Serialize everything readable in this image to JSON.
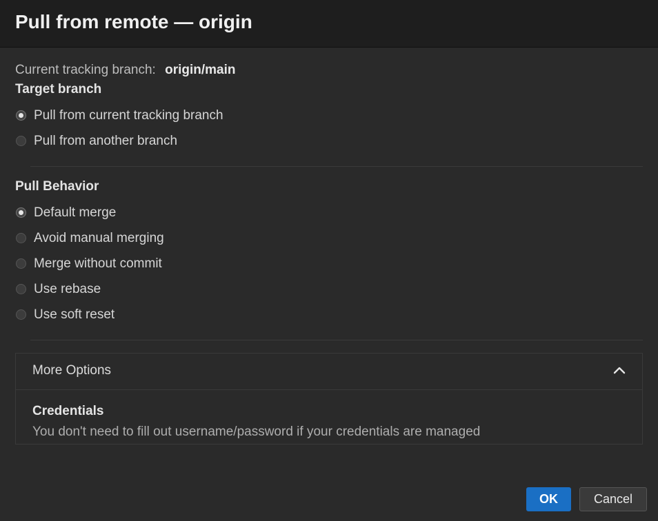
{
  "title": "Pull from remote — origin",
  "tracking": {
    "label": "Current tracking branch:",
    "value": "origin/main"
  },
  "targetBranch": {
    "label": "Target branch",
    "options": [
      {
        "label": "Pull from current tracking branch",
        "checked": true
      },
      {
        "label": "Pull from another branch",
        "checked": false
      }
    ]
  },
  "pullBehavior": {
    "label": "Pull Behavior",
    "options": [
      {
        "label": "Default merge",
        "checked": true
      },
      {
        "label": "Avoid manual merging",
        "checked": false
      },
      {
        "label": "Merge without commit",
        "checked": false
      },
      {
        "label": "Use rebase",
        "checked": false
      },
      {
        "label": "Use soft reset",
        "checked": false
      }
    ]
  },
  "moreOptions": {
    "header": "More Options",
    "expanded": true,
    "credentials": {
      "title": "Credentials",
      "desc": "You don't need to fill out username/password if your credentials are managed"
    }
  },
  "buttons": {
    "ok": "OK",
    "cancel": "Cancel"
  }
}
